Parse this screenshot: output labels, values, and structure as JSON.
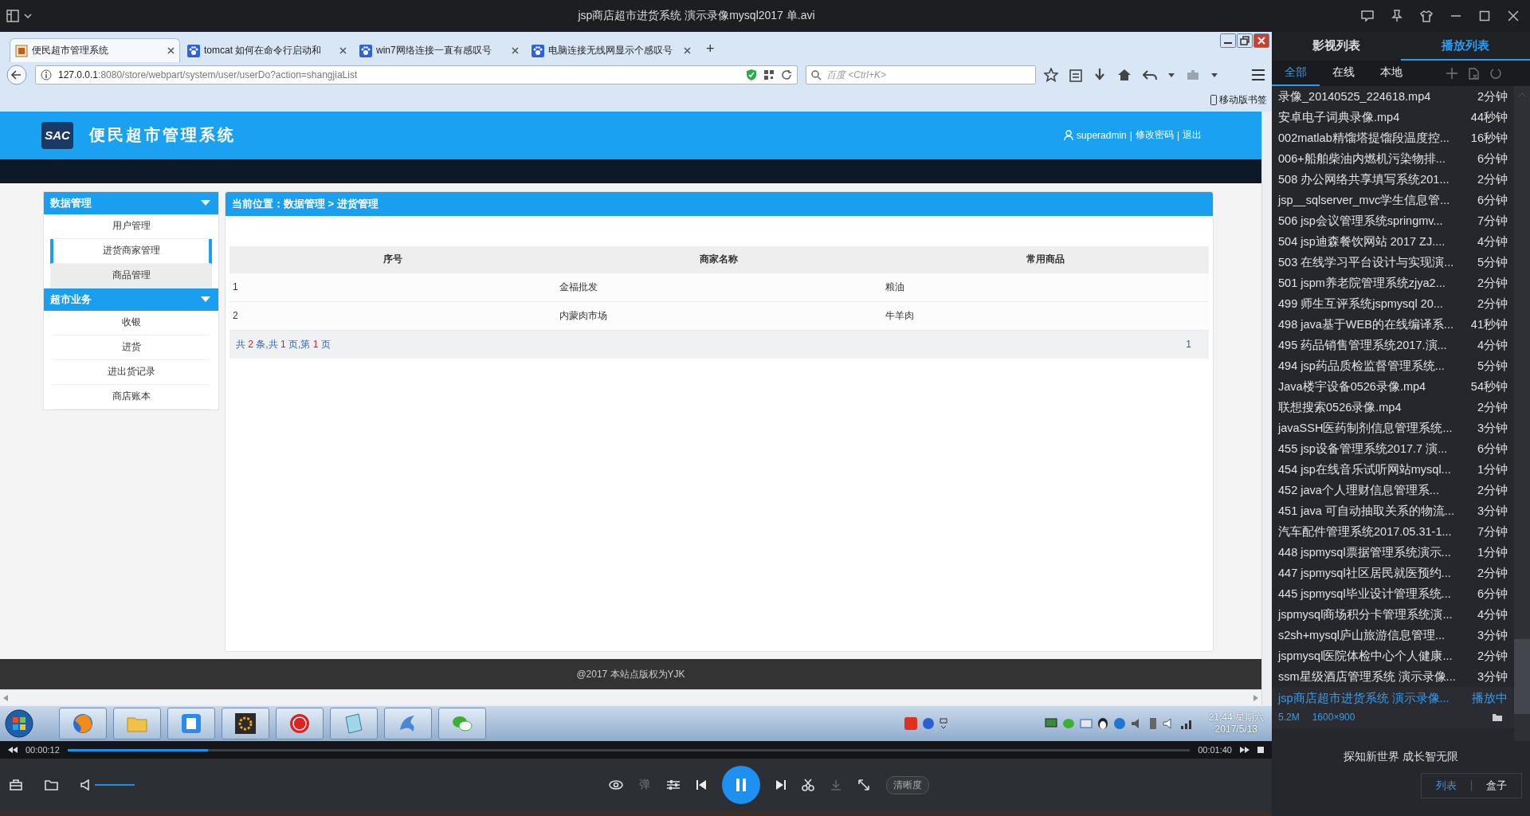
{
  "player_title": "jsp商店超市进货系统 演示录像mysql2017 单.avi",
  "browser": {
    "tabs": [
      {
        "label": "便民超市管理系统",
        "kind": "page",
        "selected": true
      },
      {
        "label": "tomcat 如何在命令行启动和",
        "kind": "paw",
        "selected": false
      },
      {
        "label": "win7网络连接一直有感叹号",
        "kind": "paw",
        "selected": false
      },
      {
        "label": "电脑连接无线网显示个感叹号",
        "kind": "paw",
        "selected": false
      }
    ],
    "new_tab": "+",
    "url_host": "127.0.0.1",
    "url_rest": ":8080/store/webpart/system/user/userDo?action=shangjiaList",
    "search_placeholder": "百度 <Ctrl+K>",
    "bookmark": "移动版书签"
  },
  "site": {
    "logo": "SAC",
    "title": "便民超市管理系统",
    "user": "superadmin",
    "separator": "|",
    "links": [
      "修改密码",
      "退出"
    ],
    "sidebar": [
      {
        "title": "数据管理",
        "items": [
          {
            "label": "用户管理",
            "selected": false,
            "hovered": false
          },
          {
            "label": "进货商家管理",
            "selected": true,
            "hovered": false
          },
          {
            "label": "商品管理",
            "selected": false,
            "hovered": true
          }
        ]
      },
      {
        "title": "超市业务",
        "items": [
          {
            "label": "收银",
            "selected": false,
            "hovered": false
          },
          {
            "label": "进货",
            "selected": false,
            "hovered": false
          },
          {
            "label": "进出货记录",
            "selected": false,
            "hovered": false
          },
          {
            "label": "商店账本",
            "selected": false,
            "hovered": false
          }
        ]
      }
    ],
    "breadcrumb": "当前位置：数据管理 > 进货管理",
    "table": {
      "columns": [
        "序号",
        "商家名称",
        "常用商品"
      ],
      "rows": [
        [
          "1",
          "金福批发",
          "粮油"
        ],
        [
          "2",
          "内蒙肉市场",
          "牛羊肉"
        ]
      ]
    },
    "pagination": {
      "summary": [
        {
          "text": "共 ",
          "emphasis": false
        },
        {
          "text": "2",
          "emphasis": true
        },
        {
          "text": " 条,共 ",
          "emphasis": false
        },
        {
          "text": "1",
          "emphasis": true
        },
        {
          "text": " 页,第 ",
          "emphasis": false
        },
        {
          "text": "1",
          "emphasis": true
        },
        {
          "text": " 页",
          "emphasis": false
        }
      ],
      "pages": [
        "1"
      ]
    },
    "footer": "@2017 本站点版权为YJK"
  },
  "taskbar": {
    "time": "21:44 星期六",
    "date": "2017/5/13"
  },
  "playback": {
    "elapsed": "00:00:12",
    "total": "00:01:40",
    "level": 0.125,
    "volume": {
      "level": 1
    },
    "danmaku": "弹",
    "quality": "清晰度",
    "playing": true
  },
  "playlist": {
    "tabs": [
      {
        "label": "影视列表",
        "selected": false
      },
      {
        "label": "播放列表",
        "selected": true
      }
    ],
    "filters": [
      {
        "label": "全部",
        "selected": true
      },
      {
        "label": "在线",
        "selected": false
      },
      {
        "label": "本地",
        "selected": false
      }
    ],
    "items": [
      {
        "name": "录像_20140525_224618.mp4",
        "duration": "2分钟",
        "playing": false
      },
      {
        "name": "安卓电子词典录像.mp4",
        "duration": "44秒钟",
        "playing": false
      },
      {
        "name": "002matlab精馏塔提馏段温度控...",
        "duration": "16秒钟",
        "playing": false
      },
      {
        "name": "006+船舶柴油内燃机污染物排...",
        "duration": "6分钟",
        "playing": false
      },
      {
        "name": "508 办公网络共享填写系统201...",
        "duration": "2分钟",
        "playing": false
      },
      {
        "name": "jsp__sqlserver_mvc学生信息管...",
        "duration": "6分钟",
        "playing": false
      },
      {
        "name": "506 jsp会议管理系统springmv...",
        "duration": "7分钟",
        "playing": false
      },
      {
        "name": "504 jsp迪森餐饮网站 2017 ZJ....",
        "duration": "4分钟",
        "playing": false
      },
      {
        "name": "503 在线学习平台设计与实现演...",
        "duration": "5分钟",
        "playing": false
      },
      {
        "name": "501 jspm养老院管理系统zjya2...",
        "duration": "2分钟",
        "playing": false
      },
      {
        "name": "499 师生互评系统jspmysql 20...",
        "duration": "2分钟",
        "playing": false
      },
      {
        "name": "498 java基于WEB的在线编译系...",
        "duration": "41秒钟",
        "playing": false
      },
      {
        "name": "495 药品销售管理系统2017.演...",
        "duration": "4分钟",
        "playing": false
      },
      {
        "name": "494 jsp药品质检监督管理系统...",
        "duration": "5分钟",
        "playing": false
      },
      {
        "name": "Java楼宇设备0526录像.mp4",
        "duration": "54秒钟",
        "playing": false
      },
      {
        "name": "联想搜索0526录像.mp4",
        "duration": "2分钟",
        "playing": false
      },
      {
        "name": "javaSSH医药制剂信息管理系统...",
        "duration": "3分钟",
        "playing": false
      },
      {
        "name": "455 jsp设备管理系统2017.7  演...",
        "duration": "6分钟",
        "playing": false
      },
      {
        "name": "454 jsp在线音乐试听网站mysql...",
        "duration": "1分钟",
        "playing": false
      },
      {
        "name": "452 java个人理财信息管理系...",
        "duration": "2分钟",
        "playing": false
      },
      {
        "name": "451 java 可自动抽取关系的物流...",
        "duration": "3分钟",
        "playing": false
      },
      {
        "name": "汽车配件管理系统2017.05.31-1...",
        "duration": "7分钟",
        "playing": false
      },
      {
        "name": "448 jspmysql票据管理系统演示...",
        "duration": "1分钟",
        "playing": false
      },
      {
        "name": "447 jspmysql社区居民就医预约...",
        "duration": "2分钟",
        "playing": false
      },
      {
        "name": "445 jspmysql毕业设计管理系统...",
        "duration": "6分钟",
        "playing": false
      },
      {
        "name": "jspmysql商场积分卡管理系统演...",
        "duration": "4分钟",
        "playing": false
      },
      {
        "name": "s2sh+mysql庐山旅游信息管理...",
        "duration": "3分钟",
        "playing": false
      },
      {
        "name": "jspmysql医院体检中心个人健康...",
        "duration": "2分钟",
        "playing": false
      },
      {
        "name": "ssm星级酒店管理系统 演示录像...",
        "duration": "3分钟",
        "playing": false
      },
      {
        "name": "jsp商店超市进货系统 演示录像...",
        "duration": "播放中",
        "size": "5.2M",
        "resolution": "1600×900",
        "playing": true
      }
    ],
    "slogan": "探知新世界 成长智无限",
    "view_buttons": [
      {
        "label": "列表",
        "selected": true
      },
      {
        "label": "盒子",
        "selected": false
      }
    ]
  }
}
